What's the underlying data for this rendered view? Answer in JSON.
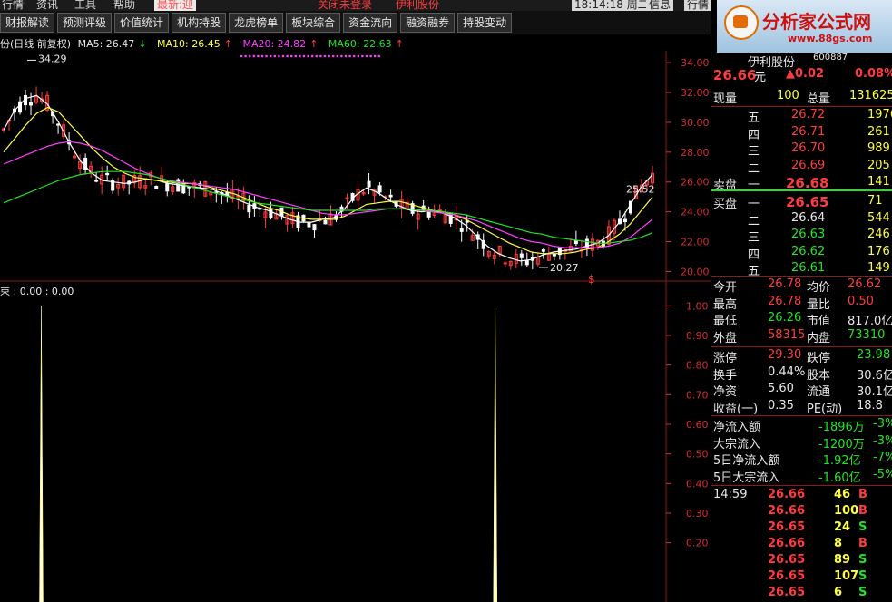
{
  "menu": [
    "行情",
    "资讯",
    "工具",
    "帮助",
    "最新:迎",
    "关闭未登录",
    "伊利股份",
    "18:14:18 周二",
    "信息",
    "行情"
  ],
  "toolbar": [
    "财报解读",
    "预测评级",
    "价值统计",
    "机构持股",
    "龙虎榜单",
    "板块综合",
    "资金流向",
    "融资融券",
    "持股变动"
  ],
  "ma_header": {
    "title": "份(日线 前复权)",
    "ma5": "MA5: 26.47",
    "ma5_arrow": "↓",
    "ma10": "MA10: 26.45",
    "ma10_arrow": "↑",
    "ma20": "MA20: 24.82",
    "ma20_arrow": "↑",
    "ma60": "MA60: 22.63",
    "ma60_arrow": "↑"
  },
  "colors": {
    "up": "#ff3c3c",
    "down": "#22e322",
    "ma5": "#ffffff",
    "ma10": "#ffff40",
    "ma20": "#ff40ff",
    "ma60": "#22e322",
    "axis": "#d03030"
  },
  "chart_data": [
    {
      "type": "candlestick",
      "y_axis_ticks": [
        "34.00",
        "32.00",
        "30.00",
        "28.00",
        "26.00",
        "24.00",
        "22.00",
        "20.00"
      ],
      "ylim": [
        19.6,
        34.8
      ],
      "annotations": {
        "high": "34.29",
        "low": "20.27",
        "last": "25.52",
        "mark": "$"
      },
      "series": [
        {
          "name": "MA5",
          "values": [
            29.5,
            30.8,
            31.6,
            31.8,
            31.2,
            30.0,
            28.6,
            27.4,
            26.6,
            26.1,
            26.0,
            25.9,
            26.0,
            26.2,
            26.1,
            25.9,
            25.8,
            25.7,
            25.6,
            25.5,
            25.2,
            24.9,
            24.6,
            24.3,
            24.1,
            23.8,
            23.5,
            23.3,
            23.3,
            23.5,
            23.6,
            24.2,
            25.1,
            25.6,
            25.3,
            24.8,
            24.4,
            24.1,
            24.0,
            24.1,
            23.9,
            23.6,
            23.1,
            22.4,
            21.7,
            21.2,
            20.9,
            20.7,
            20.8,
            21.1,
            21.3,
            21.4,
            21.5,
            21.7,
            21.9,
            22.4,
            23.3,
            24.5,
            25.7,
            26.5
          ]
        },
        {
          "name": "MA10",
          "values": [
            28.0,
            28.9,
            29.8,
            30.6,
            31.0,
            30.7,
            29.9,
            29.1,
            28.3,
            27.6,
            27.0,
            26.6,
            26.3,
            26.2,
            26.1,
            26.0,
            25.9,
            25.9,
            25.8,
            25.6,
            25.4,
            25.2,
            24.9,
            24.6,
            24.3,
            24.1,
            23.8,
            23.6,
            23.5,
            23.5,
            23.5,
            23.7,
            24.1,
            24.5,
            24.6,
            24.7,
            24.7,
            24.5,
            24.3,
            24.1,
            24.0,
            23.8,
            23.5,
            23.1,
            22.7,
            22.3,
            21.9,
            21.6,
            21.3,
            21.2,
            21.2,
            21.2,
            21.3,
            21.5,
            21.6,
            22.0,
            22.5,
            23.2,
            24.1,
            25.0
          ]
        },
        {
          "name": "MA20",
          "values": [
            27.2,
            27.5,
            27.8,
            28.1,
            28.4,
            28.6,
            28.7,
            28.6,
            28.4,
            28.1,
            27.7,
            27.3,
            26.9,
            26.6,
            26.3,
            26.1,
            26.0,
            25.9,
            25.8,
            25.7,
            25.6,
            25.5,
            25.3,
            25.1,
            24.9,
            24.7,
            24.5,
            24.3,
            24.1,
            23.9,
            23.8,
            23.8,
            23.9,
            24.0,
            24.1,
            24.2,
            24.2,
            24.2,
            24.1,
            24.0,
            23.9,
            23.8,
            23.6,
            23.4,
            23.1,
            22.8,
            22.5,
            22.2,
            22.0,
            21.9,
            21.7,
            21.6,
            21.6,
            21.6,
            21.6,
            21.7,
            21.9,
            22.3,
            22.9,
            23.5
          ]
        },
        {
          "name": "MA60",
          "values": [
            24.6,
            24.9,
            25.2,
            25.5,
            25.8,
            26.1,
            26.3,
            26.5,
            26.6,
            26.7,
            26.7,
            26.7,
            26.6,
            26.5,
            26.3,
            26.1,
            25.9,
            25.7,
            25.5,
            25.3,
            25.1,
            24.9,
            24.8,
            24.6,
            24.5,
            24.4,
            24.3,
            24.2,
            24.1,
            24.1,
            24.1,
            24.1,
            24.1,
            24.1,
            24.2,
            24.2,
            24.2,
            24.2,
            24.1,
            24.1,
            24.0,
            23.9,
            23.8,
            23.6,
            23.4,
            23.2,
            23.0,
            22.8,
            22.6,
            22.5,
            22.3,
            22.2,
            22.1,
            22.0,
            21.9,
            21.9,
            22.0,
            22.1,
            22.3,
            22.6
          ]
        }
      ]
    },
    {
      "type": "bar",
      "title": "束 : 0.00 : 0.00",
      "y_axis_ticks": [
        "1.00",
        "0.90",
        "0.80",
        "0.70",
        "0.60",
        "0.50",
        "0.40",
        "0.30",
        "0.20"
      ],
      "ylim": [
        0,
        1.05
      ],
      "spike_positions": [
        0.06,
        0.75
      ],
      "values": [
        1.0,
        1.0
      ]
    }
  ],
  "quote": {
    "name": "伊利股份",
    "code": "600887",
    "price": "26.66",
    "price_unit": "元",
    "change": "▲0.02",
    "pct": "0.08%",
    "xianliang_label": "现量",
    "xianliang": "100",
    "zongliang_label": "总量",
    "zongliang": "131625",
    "sell": [
      {
        "lv": "五",
        "p": "26.72",
        "v": "1976"
      },
      {
        "lv": "四",
        "p": "26.71",
        "v": "261"
      },
      {
        "lv": "三",
        "p": "26.70",
        "v": "989"
      },
      {
        "lv": "二",
        "p": "26.69",
        "v": "205"
      },
      {
        "lv": "一",
        "p": "26.68",
        "v": "141"
      }
    ],
    "sell_label": "卖盘",
    "buy_label": "买盘",
    "buy": [
      {
        "lv": "一",
        "p": "26.65",
        "v": "71"
      },
      {
        "lv": "二",
        "p": "26.64",
        "v": "544"
      },
      {
        "lv": "三",
        "p": "26.63",
        "v": "246"
      },
      {
        "lv": "四",
        "p": "26.62",
        "v": "176"
      },
      {
        "lv": "五",
        "p": "26.61",
        "v": "149"
      }
    ],
    "stats": [
      {
        "l1": "今开",
        "v1": "26.78",
        "c1": "red",
        "l2": "均价",
        "v2": "26.62",
        "c2": "red"
      },
      {
        "l1": "最高",
        "v1": "26.78",
        "c1": "red",
        "l2": "量比",
        "v2": "0.50",
        "c2": "red"
      },
      {
        "l1": "最低",
        "v1": "26.26",
        "c1": "green",
        "l2": "市值",
        "v2": "817.0亿",
        "c2": "white"
      },
      {
        "l1": "外盘",
        "v1": "58315",
        "c1": "red",
        "l2": "内盘",
        "v2": "73310",
        "c2": "green"
      }
    ],
    "stats2": [
      {
        "l1": "涨停",
        "v1": "29.30",
        "c1": "red",
        "l2": "跌停",
        "v2": "23.98",
        "c2": "green"
      },
      {
        "l1": "换手",
        "v1": "0.44%",
        "c1": "white",
        "l2": "股本",
        "v2": "30.6亿",
        "c2": "white"
      },
      {
        "l1": "净资",
        "v1": "5.60",
        "c1": "white",
        "l2": "流通",
        "v2": "30.1亿",
        "c2": "white"
      },
      {
        "l1": "收益(一)",
        "v1": "0.35",
        "c1": "white",
        "l2": "PE(动)",
        "v2": "18.8",
        "c2": "white"
      }
    ],
    "flows": [
      {
        "l": "净流入额",
        "v": "-1896万",
        "p": "-3%"
      },
      {
        "l": "大宗流入",
        "v": "-1200万",
        "p": "-3%"
      },
      {
        "l": "5日净流入额",
        "v": "-1.92亿",
        "p": "-7%"
      },
      {
        "l": "5日大宗流入",
        "v": "-1.60亿",
        "p": "-5%"
      }
    ],
    "ticks": [
      {
        "t": "14:59",
        "p": "26.66",
        "v": "46",
        "s": "B"
      },
      {
        "t": "",
        "p": "26.66",
        "v": "100",
        "s": "B"
      },
      {
        "t": "",
        "p": "26.65",
        "v": "24",
        "s": "S"
      },
      {
        "t": "",
        "p": "26.66",
        "v": "8",
        "s": "B"
      },
      {
        "t": "",
        "p": "26.65",
        "v": "89",
        "s": "S"
      },
      {
        "t": "",
        "p": "26.65",
        "v": "107",
        "s": "S"
      },
      {
        "t": "",
        "p": "26.65",
        "v": "6",
        "s": "S"
      }
    ]
  },
  "watermark": {
    "title": "分析家公式网",
    "url": "www.88gs.com"
  }
}
